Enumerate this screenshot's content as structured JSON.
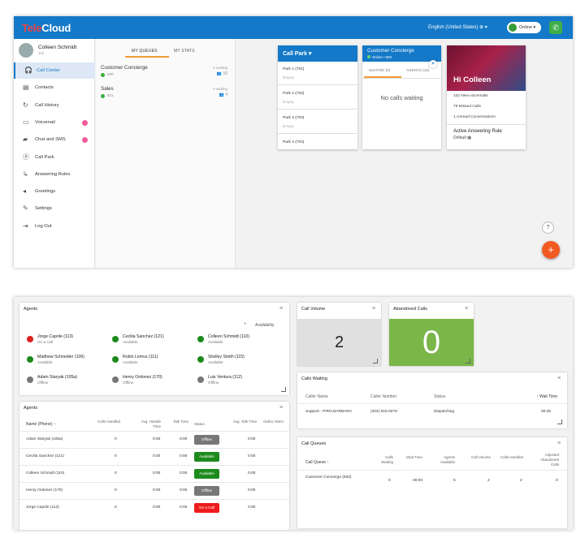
{
  "brand": {
    "prefix": "Tele",
    "suffix": "Cloud",
    "accent": "#1479c8"
  },
  "header": {
    "language": "English (United States)",
    "status": "Online",
    "phone_icon": "phone-icon"
  },
  "user": {
    "name": "Colleen Schmidt",
    "ext": "110"
  },
  "nav": [
    {
      "label": "Call Center",
      "icon": "headset-icon",
      "active": true
    },
    {
      "label": "Contacts",
      "icon": "contacts-icon"
    },
    {
      "label": "Call History",
      "icon": "call-history-icon"
    },
    {
      "label": "Voicemail",
      "icon": "voicemail-icon",
      "badge": true
    },
    {
      "label": "Chat and SMS",
      "icon": "chat-icon",
      "badge": true
    },
    {
      "label": "Call Park",
      "icon": "call-park-icon"
    },
    {
      "label": "Answering Rules",
      "icon": "answering-rules-icon"
    },
    {
      "label": "Greetings",
      "icon": "greetings-icon"
    },
    {
      "label": "Settings",
      "icon": "settings-icon"
    },
    {
      "label": "Log Out",
      "icon": "logout-icon"
    }
  ],
  "queues_panel": {
    "tab_queues": "MY QUEUES",
    "tab_stats": "MY STATS",
    "queues": [
      {
        "name": "Customer Concierge",
        "number": "920",
        "waiting": "0 waiting",
        "agents": "10"
      },
      {
        "name": "Sales",
        "number": "921",
        "waiting": "0 waiting",
        "agents": "4"
      }
    ]
  },
  "call_park": {
    "title": "Call Park",
    "slots": [
      {
        "label": "Park 1 (701)",
        "status": "Empty"
      },
      {
        "label": "Park 2 (702)",
        "status": "Empty"
      },
      {
        "label": "Park 3 (703)",
        "status": "Empty"
      },
      {
        "label": "Park 4 (704)",
        "status": ""
      }
    ]
  },
  "queue_card": {
    "title": "Customer Concierge",
    "subtitle": "Online • 920",
    "tab_waiting": "WAITING (0)",
    "tab_agents": "AGENTS (10)",
    "empty": "No calls waiting"
  },
  "hi_card": {
    "greeting": "Hi Colleen",
    "line1": "102 New voicemails",
    "line2": "79 Missed Calls",
    "line3": "1 Unread Conversations",
    "rule_title": "Active Answering Rule",
    "rule_value": "Default"
  },
  "agents_panel": {
    "title": "Agents",
    "availability": "Availability",
    "agents": [
      {
        "name": "Jorge Caprile (113)",
        "status": "On a Call",
        "color": "#e02020"
      },
      {
        "name": "Cecilia Sanchez (121)",
        "status": "Available",
        "color": "#1c8a1c"
      },
      {
        "name": "Colleen Schmidt (110)",
        "status": "Available",
        "color": "#1c8a1c"
      },
      {
        "name": "Matthew Schneider (106)",
        "status": "Available",
        "color": "#1c8a1c"
      },
      {
        "name": "Robin Lemus (111)",
        "status": "Available",
        "color": "#1c8a1c"
      },
      {
        "name": "Shelley Smith (115)",
        "status": "Available",
        "color": "#1c8a1c"
      },
      {
        "name": "Adam Staryak (105a)",
        "status": "Offline",
        "color": "#777777"
      },
      {
        "name": "Henry Ordonez (170)",
        "status": "Offline",
        "color": "#777777"
      },
      {
        "name": "Luis Ventura (112)",
        "status": "Offline",
        "color": "#777777"
      }
    ]
  },
  "agents_table": {
    "title": "Agents",
    "headers": {
      "name": "Name (Phone) ↑",
      "calls": "Calls Handled",
      "aht": "Avg. Handle Time",
      "talk": "Talk Time",
      "status": "Status",
      "avg_talk": "Avg. Talk Time",
      "dnd": "Outbo Attem"
    },
    "rows": [
      {
        "name": "Adam Staryak (105a)",
        "calls": "0",
        "aht": "0:00",
        "talk": "0:00",
        "status": "Offline",
        "color": "#777777",
        "avg_talk": "0:00"
      },
      {
        "name": "Cecilia Sanchez (121)",
        "calls": "0",
        "aht": "0:00",
        "talk": "0:00",
        "status": "Available",
        "color": "#1c8a1c",
        "avg_talk": "0:00"
      },
      {
        "name": "Colleen Schmidt (110)",
        "calls": "0",
        "aht": "0:00",
        "talk": "0:00",
        "status": "Available",
        "color": "#1c8a1c",
        "avg_talk": "0:00"
      },
      {
        "name": "Henry Ordonez (170)",
        "calls": "0",
        "aht": "0:00",
        "talk": "0:00",
        "status": "Offline",
        "color": "#777777",
        "avg_talk": "0:00"
      },
      {
        "name": "Jorge Caprile (113)",
        "calls": "0",
        "aht": "0:00",
        "talk": "0:00",
        "status": "On a Call",
        "color": "#ee1c1c",
        "avg_talk": "0:00"
      }
    ]
  },
  "call_volume": {
    "title": "Call Volume",
    "value": "2",
    "bg": "#e0e0e0"
  },
  "abandoned": {
    "title": "Abandoned Calls",
    "value": "0",
    "bg": "#7ab648"
  },
  "calls_waiting": {
    "title": "Calls Waiting",
    "headers": {
      "caller": "Caller Name",
      "number": "Caller Number",
      "status": "Status",
      "wait": "↑ Wait Time"
    },
    "row": {
      "caller": "Support - PIRO,BARBARA",
      "number": "(302) 815-0279",
      "status": "Dispatching",
      "wait": "00:36"
    }
  },
  "call_queues": {
    "title": "Call Queues",
    "headers": {
      "queue": "Call Queue ↑",
      "waiting": "Calls Waiting",
      "wait": "Wait Time",
      "agents": "Agents Available",
      "volume": "Call Volume",
      "handled": "Calls Handled",
      "adj": "Adjusted Abandoned Calls"
    },
    "row": {
      "queue": "Customer Concierge (920)",
      "waiting": "0",
      "wait": "00:00",
      "agents": "5",
      "volume": "2",
      "handled": "2",
      "adj": "0"
    }
  }
}
